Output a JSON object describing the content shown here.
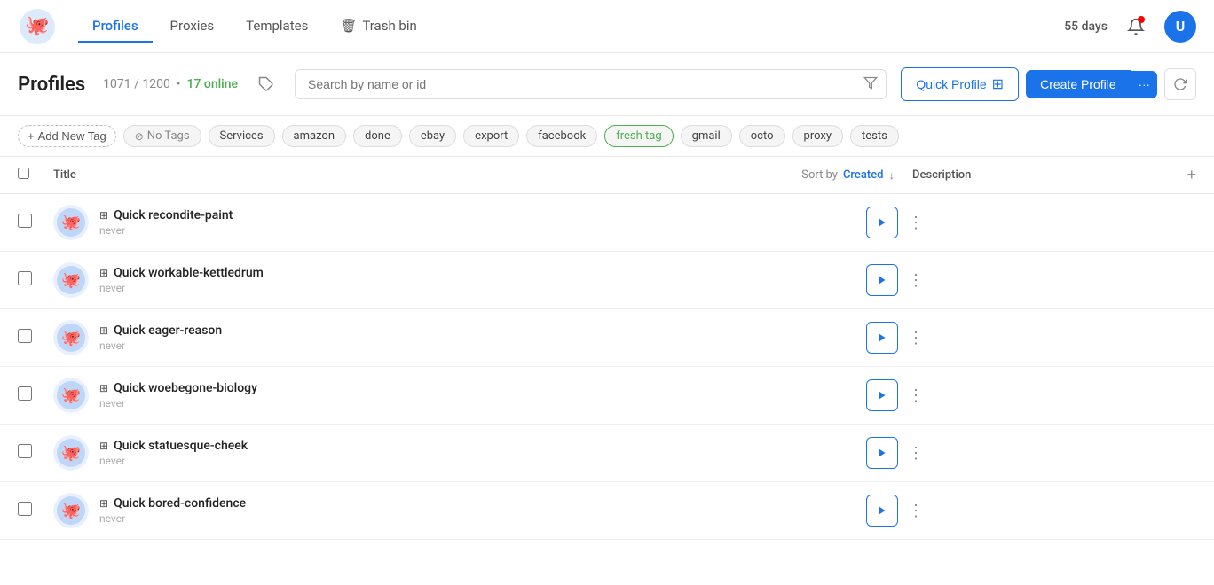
{
  "nav": {
    "links": [
      {
        "id": "profiles",
        "label": "Profiles",
        "active": true
      },
      {
        "id": "proxies",
        "label": "Proxies",
        "active": false
      },
      {
        "id": "templates",
        "label": "Templates",
        "active": false
      },
      {
        "id": "trash",
        "label": "Trash bin",
        "active": false,
        "icon": "trash"
      }
    ],
    "days": "55 days",
    "avatar_letter": "U"
  },
  "header": {
    "title": "Profiles",
    "count": "1071 / 1200",
    "online": "17 online",
    "search_placeholder": "Search by name or id",
    "quick_profile_label": "Quick Profile",
    "create_profile_label": "Create Profile"
  },
  "tags": {
    "add_label": "Add New Tag",
    "items": [
      {
        "id": "no-tags",
        "label": "No Tags",
        "has_icon": true
      },
      {
        "id": "services",
        "label": "Services",
        "has_icon": false
      },
      {
        "id": "amazon",
        "label": "amazon",
        "has_icon": false
      },
      {
        "id": "done",
        "label": "done",
        "has_icon": false
      },
      {
        "id": "ebay",
        "label": "ebay",
        "has_icon": false
      },
      {
        "id": "export",
        "label": "export",
        "has_icon": false
      },
      {
        "id": "facebook",
        "label": "facebook",
        "has_icon": false
      },
      {
        "id": "fresh-tag",
        "label": "fresh tag",
        "has_icon": false
      },
      {
        "id": "gmail",
        "label": "gmail",
        "has_icon": false
      },
      {
        "id": "octo",
        "label": "octo",
        "has_icon": false
      },
      {
        "id": "proxy",
        "label": "proxy",
        "has_icon": false
      },
      {
        "id": "tests",
        "label": "tests",
        "has_icon": false
      }
    ]
  },
  "table": {
    "col_title": "Title",
    "col_sort_label": "Sort by",
    "col_sort_field": "Created",
    "col_desc": "Description",
    "rows": [
      {
        "id": 1,
        "title": "Quick recondite-paint",
        "sub": "never"
      },
      {
        "id": 2,
        "title": "Quick workable-kettledrum",
        "sub": "never"
      },
      {
        "id": 3,
        "title": "Quick eager-reason",
        "sub": "never"
      },
      {
        "id": 4,
        "title": "Quick woebegone-biology",
        "sub": "never"
      },
      {
        "id": 5,
        "title": "Quick statuesque-cheek",
        "sub": "never"
      },
      {
        "id": 6,
        "title": "Quick bored-confidence",
        "sub": "never"
      }
    ]
  },
  "icons": {
    "bell": "🔔",
    "trash": "🗑",
    "play": "▶",
    "more": "⋮",
    "windows": "⊞",
    "plus": "+",
    "search": "⌕",
    "filter": "⛛",
    "refresh": "↻",
    "tag": "🏷",
    "no_tag": "⊘",
    "sort_down": "↓"
  }
}
